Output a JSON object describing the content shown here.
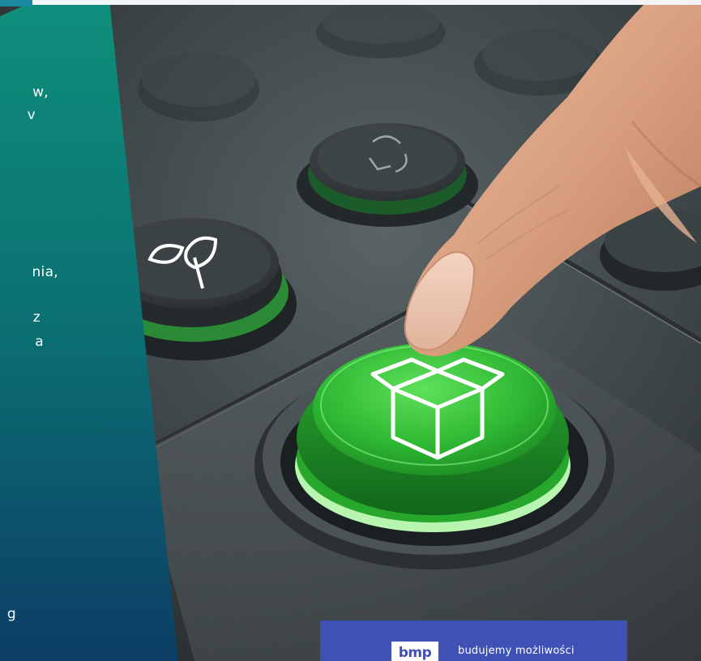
{
  "panel": {
    "fragments": [
      "w,",
      "v",
      "nia,",
      "z",
      "a",
      "g"
    ]
  },
  "brand": {
    "logo_text": "bmp",
    "tagline": "budujemy możliwości"
  },
  "colors": {
    "panel_top": "#0e8f7a",
    "panel_bottom": "#0c3d66",
    "button_green": "#37c23d",
    "brand_blue": "#3f51b5"
  },
  "icons": [
    "leaf-icon",
    "recycle-icon",
    "box-icon"
  ]
}
